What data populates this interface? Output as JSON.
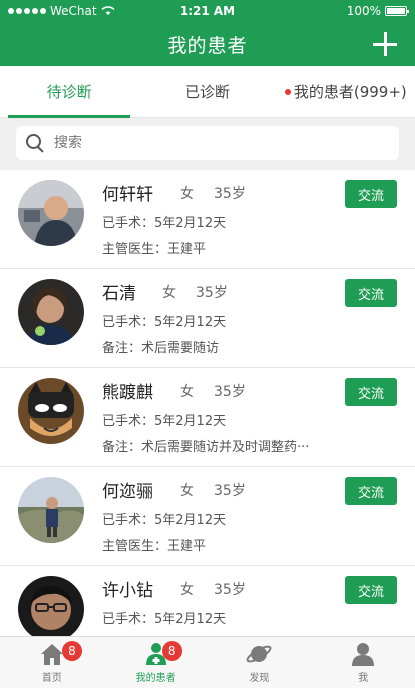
{
  "status_bar": {
    "carrier": "WeChat",
    "time": "1:21 AM",
    "battery": "100%"
  },
  "nav": {
    "title": "我的患者"
  },
  "tabs": [
    {
      "label": "待诊断",
      "active": true
    },
    {
      "label": "已诊断",
      "active": false
    },
    {
      "label": "我的患者(999+)",
      "active": false,
      "dot": true
    }
  ],
  "search": {
    "placeholder": "搜索"
  },
  "patients": [
    {
      "name": "何轩轩",
      "gender": "女",
      "age": "35岁",
      "line1": "已手术：5年2月12天",
      "line2": "主管医生：王建平",
      "button": "交流"
    },
    {
      "name": "石清",
      "gender": "女",
      "age": "35岁",
      "line1": "已手术：5年2月12天",
      "line2": "备注：术后需要随访",
      "button": "交流"
    },
    {
      "name": "熊踱麒",
      "gender": "女",
      "age": "35岁",
      "line1": "已手术：5年2月12天",
      "line2": "备注：术后需要随访并及时调整药···",
      "button": "交流"
    },
    {
      "name": "何迩骊",
      "gender": "女",
      "age": "35岁",
      "line1": "已手术：5年2月12天",
      "line2": "主管医生：王建平",
      "button": "交流"
    },
    {
      "name": "许小钻",
      "gender": "女",
      "age": "35岁",
      "line1": "已手术：5年2月12天",
      "line2": "",
      "button": "交流"
    }
  ],
  "tabbar": [
    {
      "label": "首页",
      "badge": "8",
      "icon": "home-icon"
    },
    {
      "label": "我的患者",
      "badge": "8",
      "icon": "patients-icon",
      "active": true
    },
    {
      "label": "发现",
      "icon": "planet-icon"
    },
    {
      "label": "我",
      "icon": "person-icon"
    }
  ],
  "colors": {
    "brand": "#1f9d55",
    "badge": "#e53935"
  }
}
